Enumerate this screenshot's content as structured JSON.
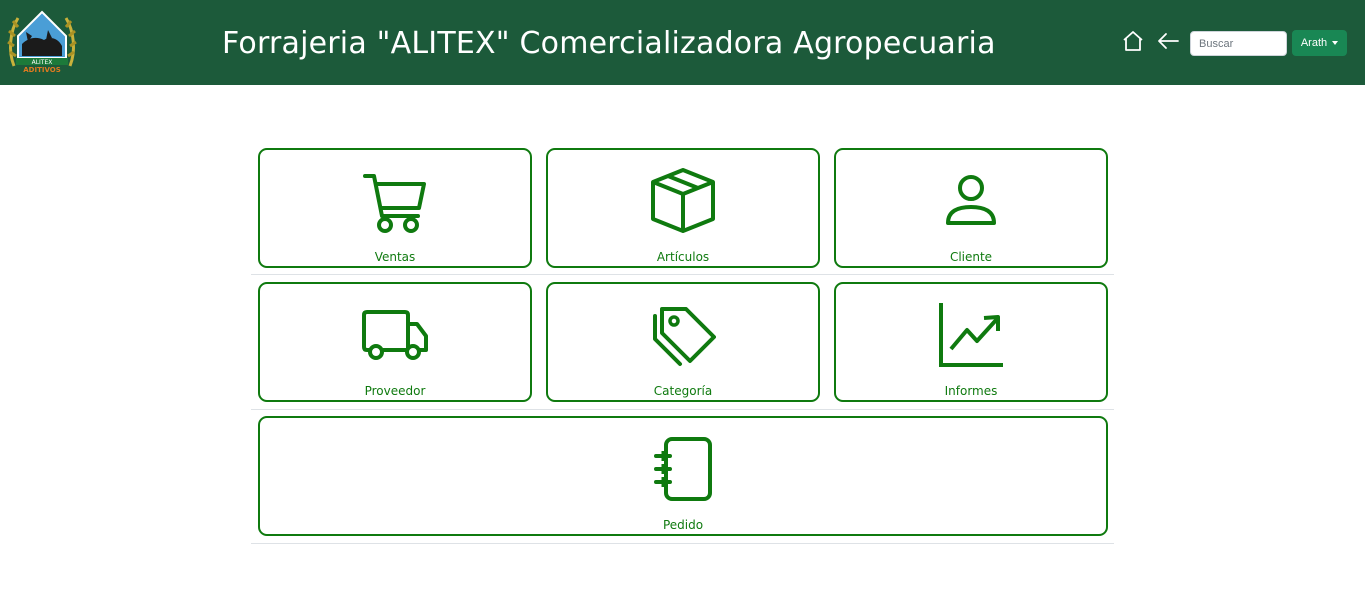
{
  "header": {
    "title": "Forrajeria \"ALITEX\" Comercializadora Agropecuaria",
    "logo_text_top": "ALITEX",
    "logo_text_bottom": "ADITIVOS",
    "search_placeholder": "Buscar",
    "user_label": "Arath",
    "home_icon": "home-icon",
    "back_icon": "arrow-left-icon"
  },
  "colors": {
    "header_bg": "#1c5a3a",
    "accent_green": "#0f7a0f",
    "user_button_bg": "#198754"
  },
  "tiles": [
    {
      "label": "Ventas",
      "icon": "shopping-cart-icon"
    },
    {
      "label": "Artículos",
      "icon": "box-icon"
    },
    {
      "label": "Cliente",
      "icon": "person-icon"
    },
    {
      "label": "Proveedor",
      "icon": "truck-icon"
    },
    {
      "label": "Categoría",
      "icon": "tags-icon"
    },
    {
      "label": "Informes",
      "icon": "graph-up-icon"
    },
    {
      "label": "Pedido",
      "icon": "journal-icon"
    }
  ]
}
